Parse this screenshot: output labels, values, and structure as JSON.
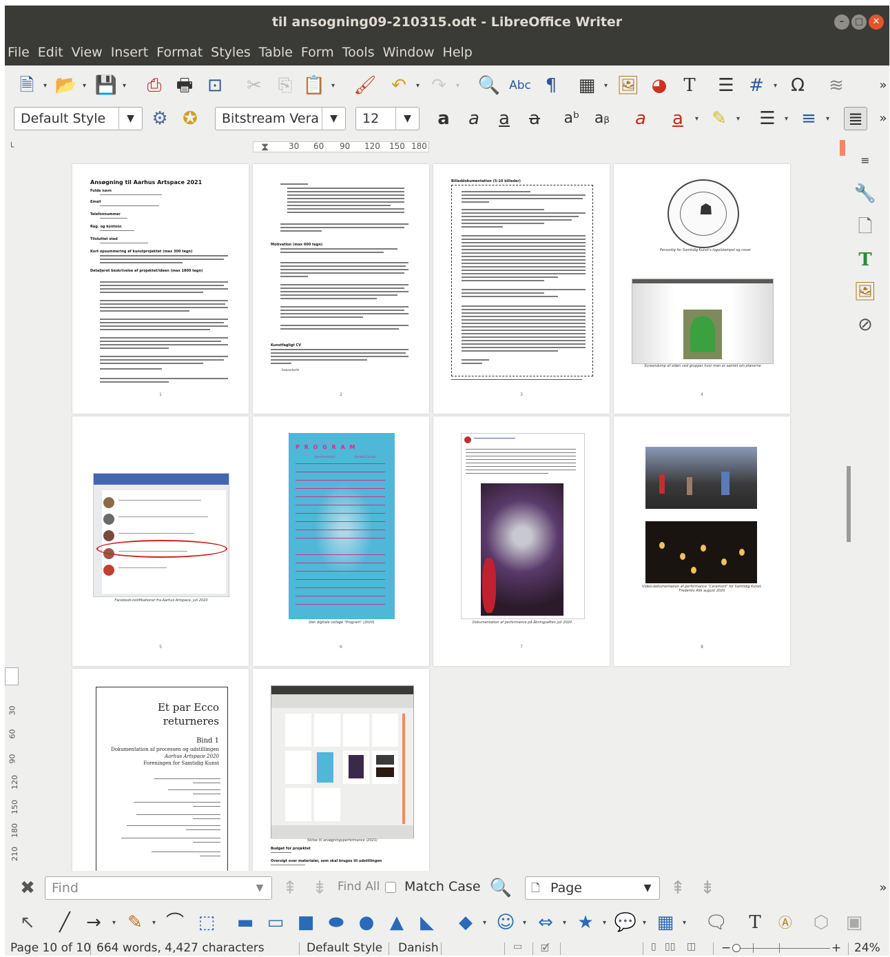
{
  "window": {
    "title": "til ansogning09-210315.odt - LibreOffice Writer"
  },
  "menu": [
    "File",
    "Edit",
    "View",
    "Insert",
    "Format",
    "Styles",
    "Table",
    "Form",
    "Tools",
    "Window",
    "Help"
  ],
  "formatting": {
    "paragraph_style": "Default Style",
    "font_name": "Bitstream Vera",
    "font_size": "12"
  },
  "ruler": {
    "ticks": [
      "30",
      "60",
      "90",
      "120",
      "150",
      "180"
    ]
  },
  "vruler": {
    "ticks": [
      "30",
      "60",
      "90",
      "120",
      "150",
      "180",
      "210"
    ]
  },
  "pages": {
    "p1_title": "Ansøgning til Aarhus Artspace 2021",
    "p1_labels": [
      "Fulde navn",
      "Email",
      "Telefonnummer",
      "Reg. og kontonr.",
      "Tilsluttet sted",
      "Kort opsummering af kunstprojektet (max 300 tegn)",
      "Detaljeret beskrivelse af projektet/ideen (max 1800 tegn)"
    ],
    "p2_labels": [
      "Motivation (max 600 tegn)",
      "Kunstfagligt CV",
      "Sewandsefel"
    ],
    "p3_title": "Billeddokumentation (5-10 billeder)",
    "p4_cap1": "Personlig for Samtidig Kunst's logo/stempel og cover",
    "p4_cap2": "Screendump af siden ved grupper hvor man er samlet om planerne",
    "p5_cap": "Facebook-notifikationer fra Aarhus Artspace, juli 2020",
    "p6_title": "P R O G R A M",
    "p6_cols": [
      "Kunstner/Artist",
      "Kurator/Curator"
    ],
    "p6_cap": "Den digitale collage \"Program\" (2020)",
    "p7_cap": "Dokumentation af performance på åbningsaften juli 2020",
    "p8_cap": "Video-dokumentation af performance \"Ceremoni\" for Samtidig Kunst, Frederiks Allé august 2020",
    "p9": {
      "title1": "Et par Ecco",
      "title2": "returneres",
      "vol": "Bind 1",
      "sub1": "Dokumentation af processen og udstillingen",
      "sub2": "Aarhus Artspace 2020",
      "sub3": "Foreningen for Samtidig Kunst"
    },
    "p10_cap": "Skitse til ansøgningsperformance (2021)",
    "p10_labels": [
      "Budget for projektet",
      "Oversigt over materialer, som skal bruges til udstillingen"
    ]
  },
  "findbar": {
    "placeholder": "Find",
    "find_all": "Find All",
    "match_case": "Match Case",
    "search_type": "Page"
  },
  "status": {
    "page": "Page 10 of 10",
    "words": "664 words, 4,427 characters",
    "style": "Default Style",
    "language": "Danish",
    "zoom": "24%"
  }
}
